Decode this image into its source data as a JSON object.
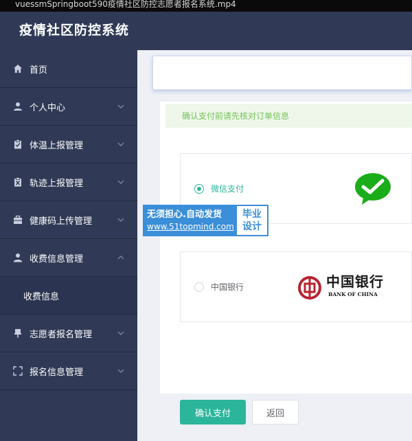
{
  "video": {
    "filename": "vuessmSpringboot590疫情社区防控志愿者报名系统.mp4"
  },
  "app": {
    "title": "疫情社区防控系统"
  },
  "sidebar": {
    "items": [
      {
        "label": "首页",
        "icon": "home-icon"
      },
      {
        "label": "个人中心",
        "icon": "user-icon"
      },
      {
        "label": "体温上报管理",
        "icon": "clipboard-check-icon"
      },
      {
        "label": "轨迹上报管理",
        "icon": "clipboard-x-icon"
      },
      {
        "label": "健康码上传管理",
        "icon": "briefcase-icon"
      },
      {
        "label": "收费信息管理",
        "icon": "user-badge-icon",
        "expanded": true
      },
      {
        "label": "志愿者报名管理",
        "icon": "pin-icon"
      },
      {
        "label": "报名信息管理",
        "icon": "fullscreen-icon"
      }
    ],
    "submenu": {
      "label": "收费信息"
    }
  },
  "main": {
    "notice": "确认支付前请先核对订单信息",
    "payment_options": [
      {
        "label": "微信支付",
        "selected": true,
        "logo": "wechat-pay-logo"
      },
      {
        "label": "中国银行",
        "selected": false,
        "logo": "bank-of-china-logo",
        "logo_text_cn": "中国银行",
        "logo_text_en": "BANK OF CHINA"
      }
    ],
    "confirm_button": "确认支付",
    "back_button": "返回"
  },
  "watermark": {
    "line1": "无须担心.自动发货",
    "line2": "www.51topmind.com",
    "badge_line1": "毕业",
    "badge_line2": "设计"
  },
  "colors": {
    "sidebar": "#303a56",
    "accent": "#2bb59b",
    "notice_bg": "#eef7ea",
    "notice_text": "#74c35b",
    "wechat_green": "#1aad19",
    "boc_red": "#b8232f",
    "watermark_blue": "#3b8ed8"
  }
}
